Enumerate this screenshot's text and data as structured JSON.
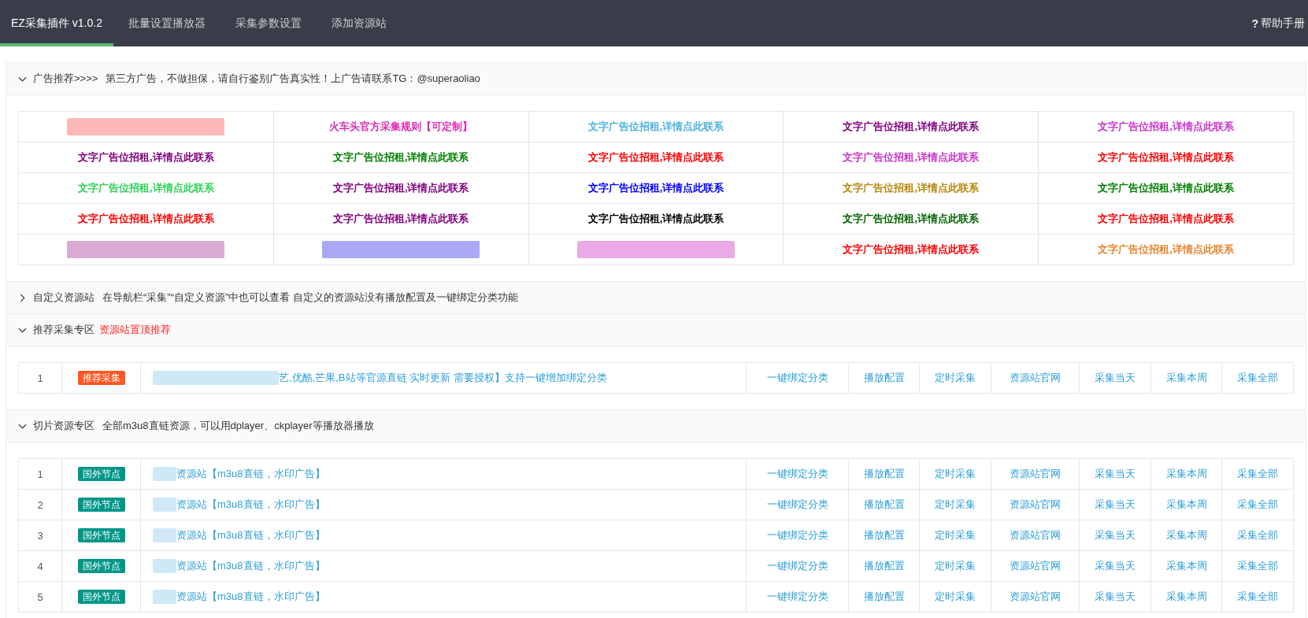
{
  "nav": {
    "tabs": [
      {
        "label": "EZ采集插件 v1.0.2",
        "selected": true
      },
      {
        "label": "批量设置播放器",
        "selected": false
      },
      {
        "label": "采集参数设置",
        "selected": false
      },
      {
        "label": "添加资源站",
        "selected": false
      }
    ],
    "help": {
      "icon": "?",
      "label": "帮助手册"
    }
  },
  "sections": [
    {
      "title": "广告推荐>>>>",
      "note": "第三方广告，不做担保，请自行鉴别广告真实性！上广告请联系TG：@superaoliao",
      "note_highlighted": false,
      "expanded": true,
      "kind": "ads",
      "ads": [
        [
          {
            "kind": "blurred",
            "color": "#ffb8b8"
          },
          {
            "kind": "text",
            "text": "火车头官方采集规则【可定制】",
            "color": "#d92cb5"
          },
          {
            "kind": "text",
            "text": "文字广告位招租,详情点此联系",
            "color": "#4db3dd"
          },
          {
            "kind": "text",
            "text": "文字广告位招租,详情点此联系",
            "color": "#800080"
          },
          {
            "kind": "text",
            "text": "文字广告位招租,详情点此联系",
            "color": "#cc33cc"
          }
        ],
        [
          {
            "kind": "text",
            "text": "文字广告位招租,详情点此联系",
            "color": "#800080"
          },
          {
            "kind": "text",
            "text": "文字广告位招租,详情点此联系",
            "color": "#008000"
          },
          {
            "kind": "text",
            "text": "文字广告位招租,详情点此联系",
            "color": "#ff0000"
          },
          {
            "kind": "text",
            "text": "文字广告位招租,详情点此联系",
            "color": "#cc33cc"
          },
          {
            "kind": "text",
            "text": "文字广告位招租,详情点此联系",
            "color": "#ff0000"
          }
        ],
        [
          {
            "kind": "text",
            "text": "文字广告位招租,详情点此联系",
            "color": "#2ed158"
          },
          {
            "kind": "text",
            "text": "文字广告位招租,详情点此联系",
            "color": "#800080"
          },
          {
            "kind": "text",
            "text": "文字广告位招租,详情点此联系",
            "color": "#0000ff"
          },
          {
            "kind": "text",
            "text": "文字广告位招租,详情点此联系",
            "color": "#b8860b"
          },
          {
            "kind": "text",
            "text": "文字广告位招租,详情点此联系",
            "color": "#008000"
          }
        ],
        [
          {
            "kind": "text",
            "text": "文字广告位招租,详情点此联系",
            "color": "#ff0000"
          },
          {
            "kind": "text",
            "text": "文字广告位招租,详情点此联系",
            "color": "#800080"
          },
          {
            "kind": "text",
            "text": "文字广告位招租,详情点此联系",
            "color": "#000000"
          },
          {
            "kind": "text",
            "text": "文字广告位招租,详情点此联系",
            "color": "#006400"
          },
          {
            "kind": "text",
            "text": "文字广告位招租,详情点此联系",
            "color": "#ff0000"
          }
        ],
        [
          {
            "kind": "blurred",
            "color": "#d9aad2"
          },
          {
            "kind": "blurred",
            "color": "#a9a9f6"
          },
          {
            "kind": "blurred",
            "color": "#e9aae6"
          },
          {
            "kind": "text",
            "text": "文字广告位招租,详情点此联系",
            "color": "#ff0000"
          },
          {
            "kind": "text",
            "text": "文字广告位招租,详情点此联系",
            "color": "#e6862e"
          }
        ]
      ]
    },
    {
      "title": "自定义资源站",
      "note": "在导航栏“采集”“自定义资源”中也可以查看 自定义的资源站没有播放配置及一键绑定分类功能",
      "note_highlighted": false,
      "expanded": false
    },
    {
      "title": "推荐采集专区",
      "note": "资源站置顶推荐",
      "note_highlighted": true,
      "expanded": true,
      "kind": "resources",
      "rows": [
        {
          "kind": "featured",
          "number": "1",
          "tag": {
            "text": "推荐采集",
            "color": "#ff5722"
          },
          "redacted": true,
          "name": "艺,优酷,芒果,B站等官源直链 实时更新 需要授权】支持一键增加绑定分类",
          "actions": [
            "一键绑定分类",
            "播放配置",
            "定时采集",
            "资源站官网",
            "采集当天",
            "采集本周",
            "采集全部"
          ]
        }
      ]
    },
    {
      "title": "切片资源专区",
      "note": "全部m3u8直链资源，可以用dplayer、ckplayer等播放器播放",
      "note_highlighted": false,
      "expanded": true,
      "kind": "resources",
      "rows": [
        {
          "kind": "node",
          "number": "1",
          "tag": {
            "text": "国外节点",
            "color": "#009688"
          },
          "redacted": true,
          "name": "资源站【m3u8直链，水印广告】",
          "actions": [
            "一键绑定分类",
            "播放配置",
            "定时采集",
            "资源站官网",
            "采集当天",
            "采集本周",
            "采集全部"
          ]
        },
        {
          "kind": "node",
          "number": "2",
          "tag": {
            "text": "国外节点",
            "color": "#009688"
          },
          "redacted": true,
          "name": "资源站【m3u8直链，水印广告】",
          "actions": [
            "一键绑定分类",
            "播放配置",
            "定时采集",
            "资源站官网",
            "采集当天",
            "采集本周",
            "采集全部"
          ]
        },
        {
          "kind": "node",
          "number": "3",
          "tag": {
            "text": "国外节点",
            "color": "#009688"
          },
          "redacted": true,
          "name": "资源站【m3u8直链，水印广告】",
          "actions": [
            "一键绑定分类",
            "播放配置",
            "定时采集",
            "资源站官网",
            "采集当天",
            "采集本周",
            "采集全部"
          ]
        },
        {
          "kind": "node",
          "number": "4",
          "tag": {
            "text": "国外节点",
            "color": "#009688"
          },
          "redacted": true,
          "name": "资源站【m3u8直链，水印广告】",
          "actions": [
            "一键绑定分类",
            "播放配置",
            "定时采集",
            "资源站官网",
            "采集当天",
            "采集本周",
            "采集全部"
          ]
        },
        {
          "kind": "node",
          "number": "5",
          "tag": {
            "text": "国外节点",
            "color": "#009688"
          },
          "redacted": true,
          "name": "资源站【m3u8直链，水印广告】",
          "actions": [
            "一键绑定分类",
            "播放配置",
            "定时采集",
            "资源站官网",
            "采集当天",
            "采集本周",
            "采集全部"
          ]
        }
      ]
    }
  ]
}
